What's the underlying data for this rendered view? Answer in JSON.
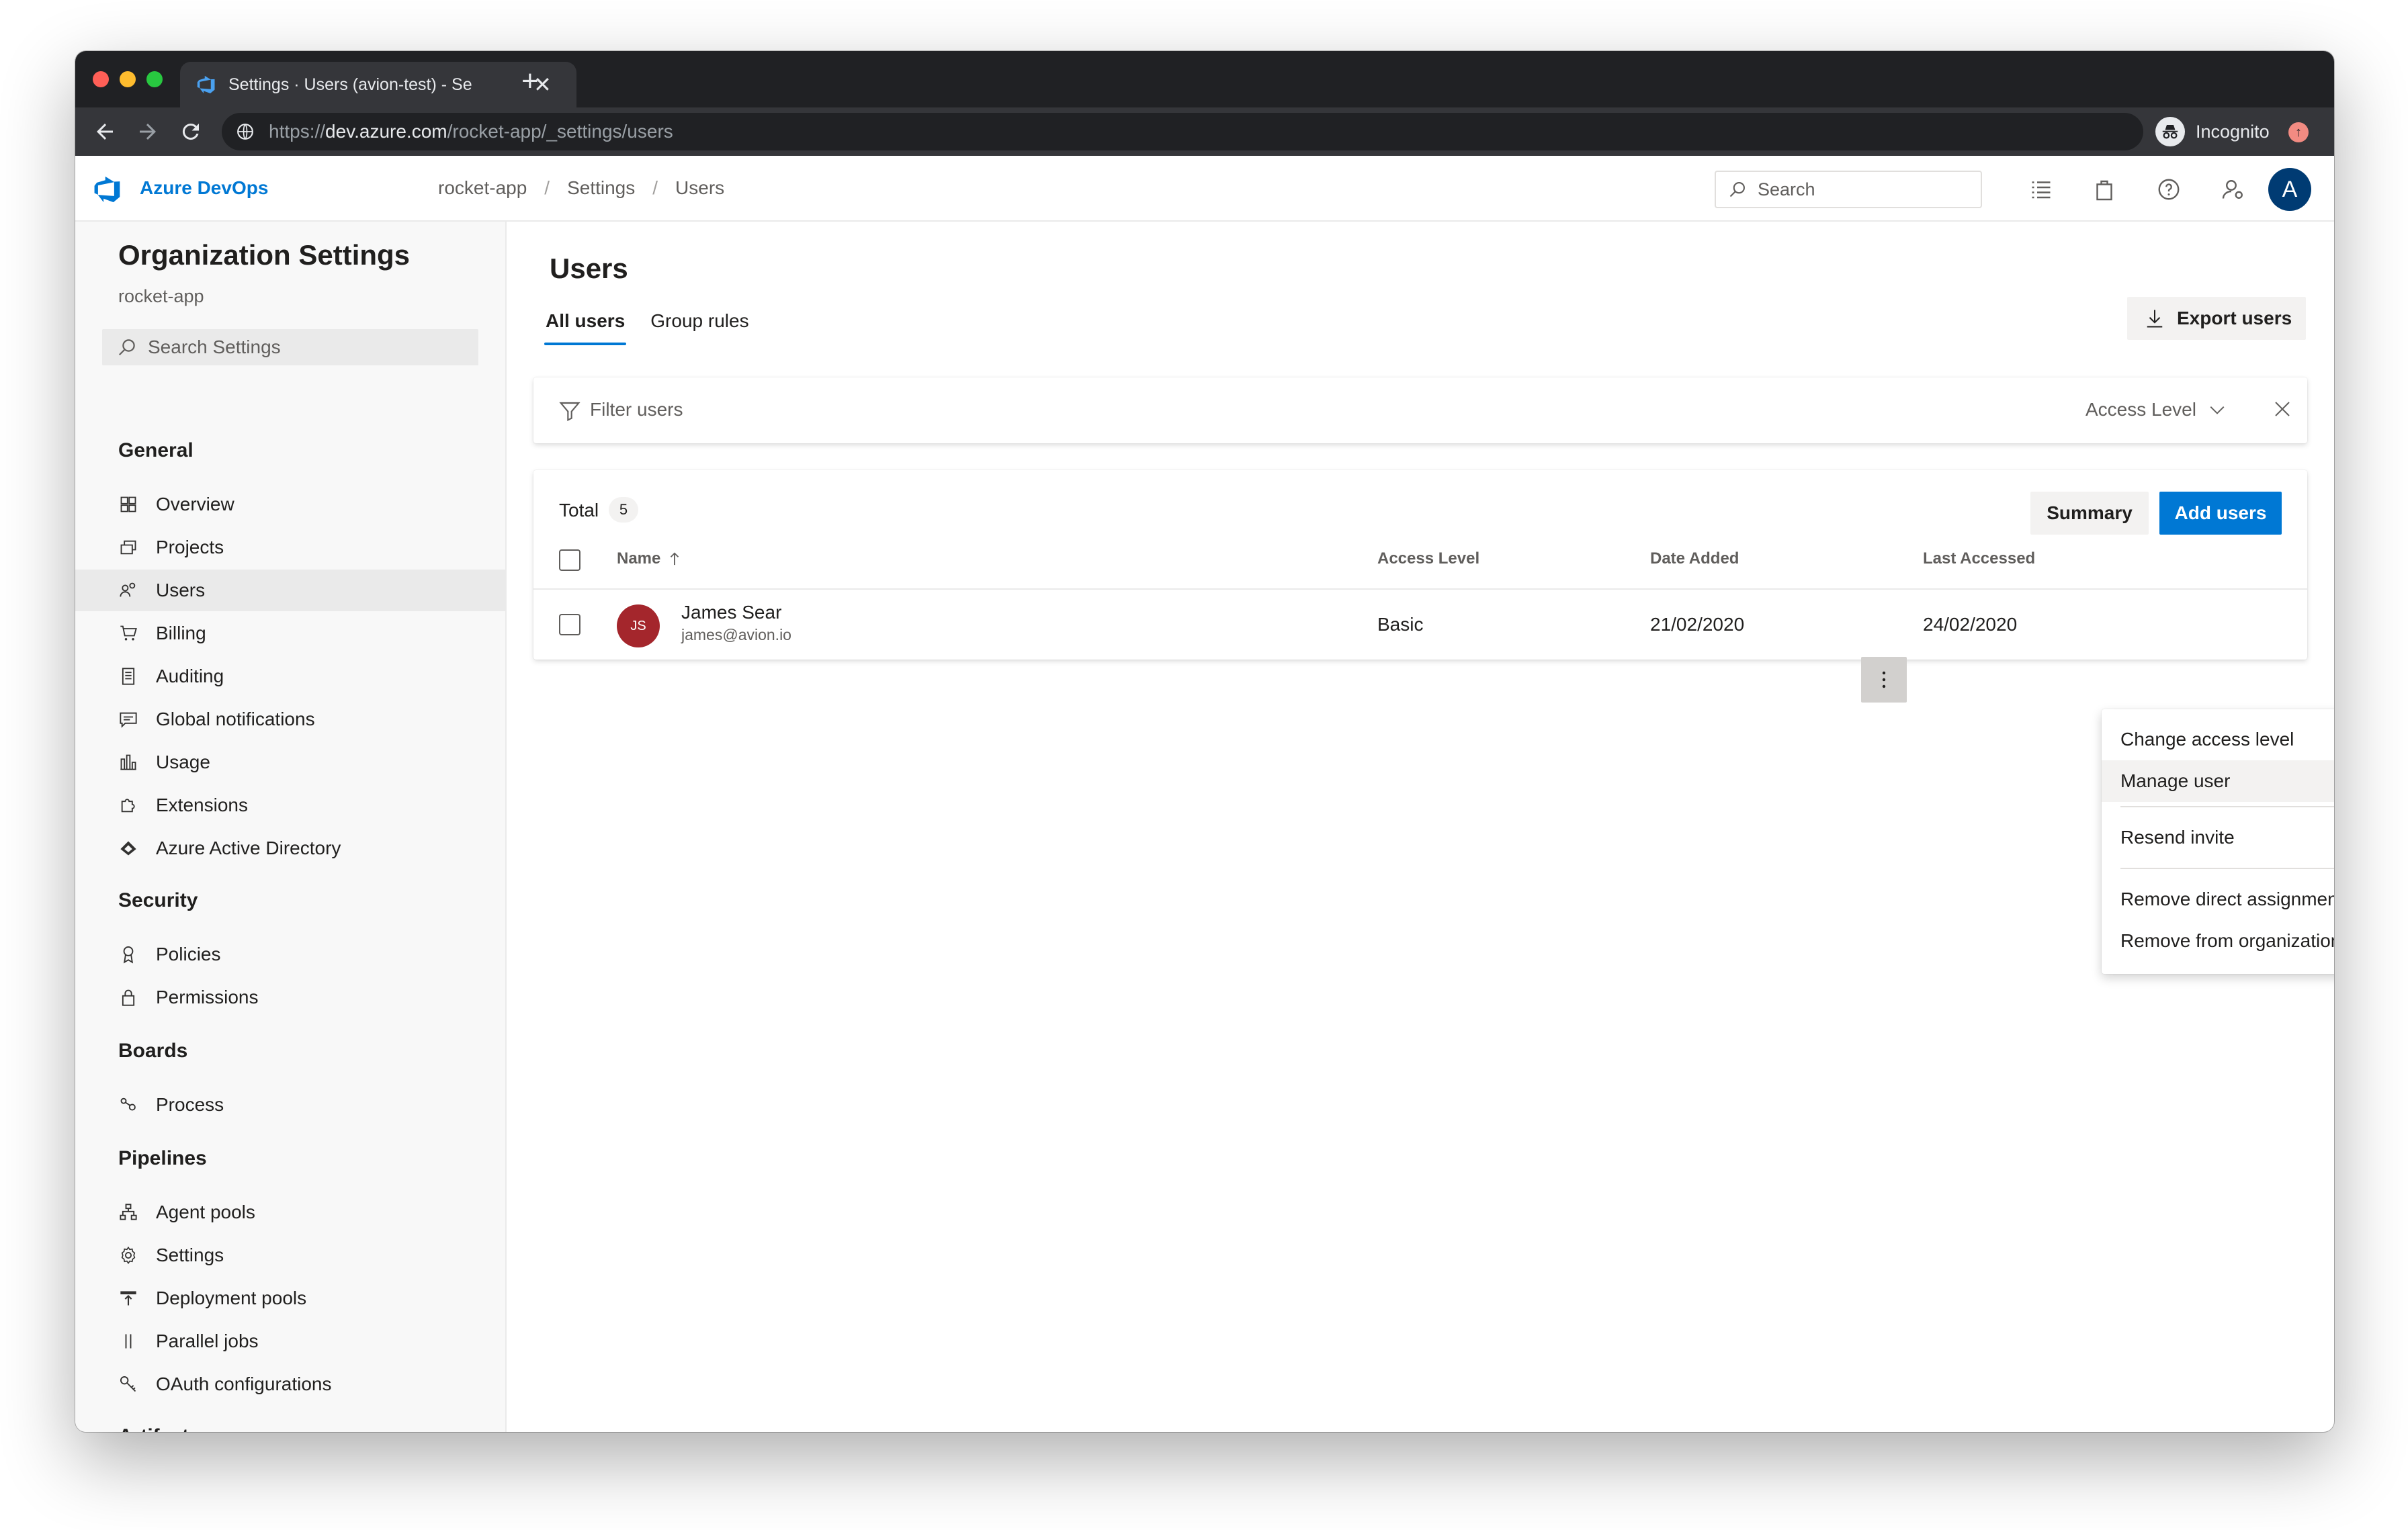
{
  "browser": {
    "tab_title": "Settings · Users (avion-test) - Se",
    "tab_close": "✕",
    "new_tab": "+",
    "url_scheme": "https://",
    "url_host": "dev.azure.com",
    "url_path": "/rocket-app/_settings/users",
    "incognito_label": "Incognito"
  },
  "header": {
    "brand": "Azure DevOps",
    "breadcrumb": [
      "rocket-app",
      "Settings",
      "Users"
    ],
    "breadcrumb_sep": "/",
    "search_placeholder": "Search",
    "avatar_initial": "A",
    "icons": [
      "list-icon",
      "shopping-bag-icon",
      "help-icon",
      "user-settings-icon"
    ]
  },
  "sidebar": {
    "title": "Organization Settings",
    "subtitle": "rocket-app",
    "search_placeholder": "Search Settings",
    "sections": {
      "general": "General",
      "security": "Security",
      "boards": "Boards",
      "pipelines": "Pipelines",
      "artifacts": "Artifacts"
    },
    "items": {
      "overview": "Overview",
      "projects": "Projects",
      "users": "Users",
      "billing": "Billing",
      "auditing": "Auditing",
      "global_notifications": "Global notifications",
      "usage": "Usage",
      "extensions": "Extensions",
      "aad": "Azure Active Directory",
      "policies": "Policies",
      "permissions": "Permissions",
      "process": "Process",
      "agent_pools": "Agent pools",
      "settings": "Settings",
      "deployment_pools": "Deployment pools",
      "parallel_jobs": "Parallel jobs",
      "oauth": "OAuth configurations"
    },
    "active_item": "Users"
  },
  "main": {
    "title": "Users",
    "tabs": [
      "All users",
      "Group rules"
    ],
    "selected_tab": "All users",
    "export_label": "Export users",
    "filter_placeholder": "Filter users",
    "access_level_filter": "Access Level",
    "total_label": "Total",
    "total_count": "5",
    "summary_label": "Summary",
    "add_users_label": "Add users",
    "columns": {
      "name": "Name",
      "access_level": "Access Level",
      "date_added": "Date Added",
      "last_accessed": "Last Accessed"
    },
    "rows": [
      {
        "initials": "JS",
        "name": "James Sear",
        "email": "james@avion.io",
        "access_level": "Basic",
        "date_added": "21/02/2020",
        "last_accessed": "24/02/2020"
      }
    ]
  },
  "context_menu": {
    "items": [
      "Change access level",
      "Manage user",
      "Resend invite",
      "Remove direct assignments",
      "Remove from organization"
    ],
    "hovered": "Manage user"
  },
  "colors": {
    "accent": "#0078d4",
    "avatar_user": "#a4262c",
    "avatar_me": "#003b73",
    "chrome_dark": "#202124"
  }
}
